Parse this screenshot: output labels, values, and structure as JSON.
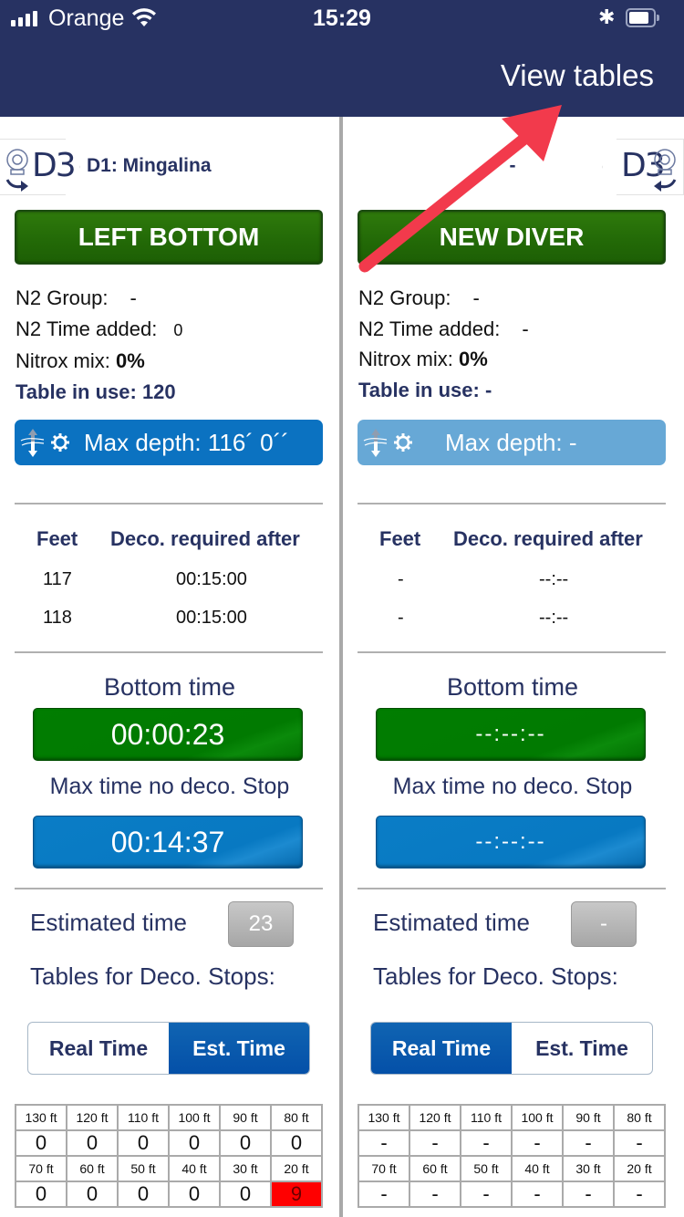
{
  "status_bar": {
    "carrier": "Orange",
    "time": "15:29"
  },
  "nav": {
    "view_tables_label": "View tables"
  },
  "left": {
    "tab_label": "D3",
    "diver_name": "D1: Mingalina",
    "action_button": "LEFT BOTTOM",
    "n2_group_label": "N2 Group:",
    "n2_group_value": "-",
    "n2_time_label": "N2 Time added:",
    "n2_time_value": "0",
    "nitrox_label": "Nitrox mix:",
    "nitrox_value": "0%",
    "table_in_use": "Table in use: 120",
    "max_depth": "Max depth: 116´ 0´´",
    "deco_headers": [
      "Feet",
      "Deco. required after"
    ],
    "deco_rows": [
      {
        "feet": "117",
        "time": "00:15:00"
      },
      {
        "feet": "118",
        "time": "00:15:00"
      }
    ],
    "bottom_time_label": "Bottom time",
    "bottom_time": "00:00:23",
    "max_no_deco_label": "Max time no deco. Stop",
    "max_no_deco": "00:14:37",
    "estimated_label": "Estimated time",
    "estimated_value": "23",
    "tables_label": "Tables for Deco. Stops:",
    "segment": {
      "options": [
        "Real Time",
        "Est. Time"
      ],
      "selected": "Est. Time"
    },
    "stops_depths_row1": [
      "130 ft",
      "120 ft",
      "110 ft",
      "100 ft",
      "90 ft",
      "80 ft"
    ],
    "stops_values_row1": [
      "0",
      "0",
      "0",
      "0",
      "0",
      "0"
    ],
    "stops_depths_row2": [
      "70 ft",
      "60 ft",
      "50 ft",
      "40 ft",
      "30 ft",
      "20 ft"
    ],
    "stops_values_row2": [
      "0",
      "0",
      "0",
      "0",
      "0",
      "9"
    ],
    "highlight_color": "#ff0000"
  },
  "right": {
    "tab_label": "D3",
    "diver_name": "-",
    "action_button": "NEW DIVER",
    "n2_group_label": "N2 Group:",
    "n2_group_value": "-",
    "n2_time_label": "N2 Time added:",
    "n2_time_value": "-",
    "nitrox_label": "Nitrox mix:",
    "nitrox_value": "0%",
    "table_in_use": "Table in use: -",
    "max_depth": "Max depth: -",
    "deco_headers": [
      "Feet",
      "Deco. required after"
    ],
    "deco_rows": [
      {
        "feet": "-",
        "time": "--:--"
      },
      {
        "feet": "-",
        "time": "--:--"
      }
    ],
    "bottom_time_label": "Bottom time",
    "bottom_time": "--:--:--",
    "max_no_deco_label": "Max time no deco. Stop",
    "max_no_deco": "--:--:--",
    "estimated_label": "Estimated time",
    "estimated_value": "-",
    "tables_label": "Tables for Deco. Stops:",
    "segment": {
      "options": [
        "Real Time",
        "Est. Time"
      ],
      "selected": "Real Time"
    },
    "stops_depths_row1": [
      "130 ft",
      "120 ft",
      "110 ft",
      "100 ft",
      "90 ft",
      "80 ft"
    ],
    "stops_values_row1": [
      "-",
      "-",
      "-",
      "-",
      "-",
      "-"
    ],
    "stops_depths_row2": [
      "70 ft",
      "60 ft",
      "50 ft",
      "40 ft",
      "30 ft",
      "20 ft"
    ],
    "stops_values_row2": [
      "-",
      "-",
      "-",
      "-",
      "-",
      "-"
    ]
  },
  "colors": {
    "nav_bg": "#273262",
    "accent_text": "#273262",
    "green_button": "#236a07",
    "blue_active": "#0b72c1",
    "blue_inactive": "#67a8d6",
    "annotation_arrow": "#f23a4c"
  }
}
